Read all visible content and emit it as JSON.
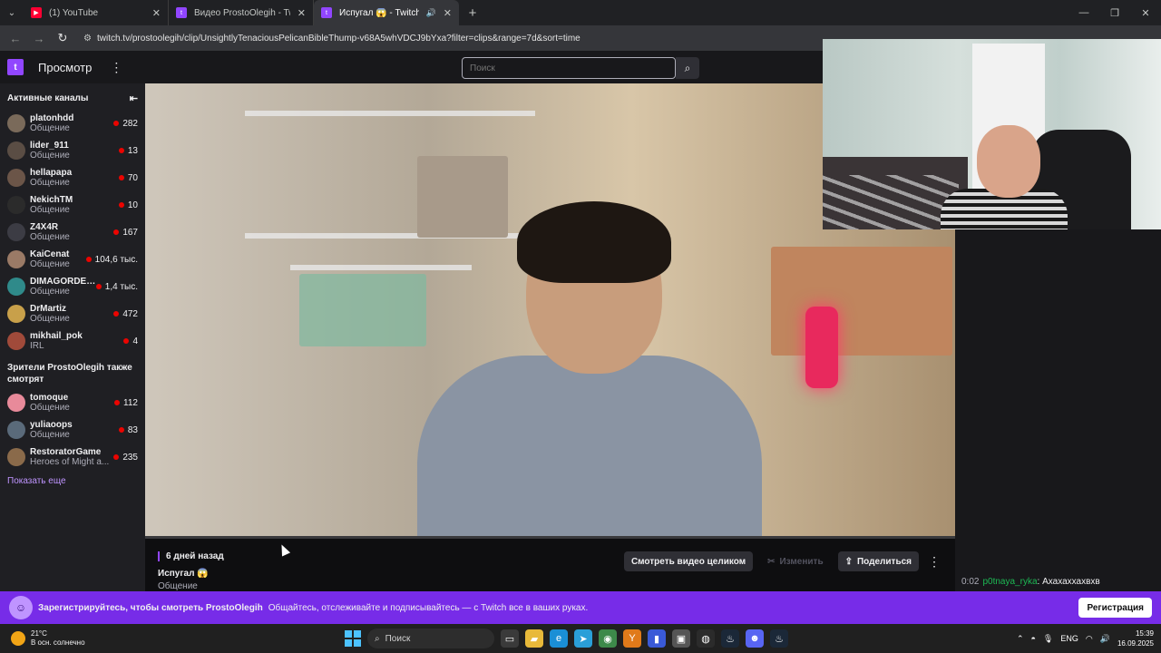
{
  "browser": {
    "tabs": [
      {
        "title": "(1) YouTube",
        "icon": "youtube-icon",
        "color": "#ff0033"
      },
      {
        "title": "Видео ProstoOlegih - Twitch",
        "icon": "twitch-icon",
        "color": "#9146ff"
      },
      {
        "title": "Испугал 😱 - Twitch",
        "icon": "twitch-icon",
        "color": "#9146ff",
        "active": true
      }
    ],
    "url": "twitch.tv/prostoolegih/clip/UnsightlyTenaciousPelicanBibleThump-v68A5whVDCJ9bYxa?filter=clips&range=7d&sort=time"
  },
  "topnav": {
    "browse": "Просмотр",
    "search_placeholder": "Поиск"
  },
  "sidebar": {
    "active_header": "Активные каналы",
    "channels": [
      {
        "name": "platonhdd",
        "category": "Общение",
        "viewers": "282",
        "color": "#7a6a5a"
      },
      {
        "name": "lider_911",
        "category": "Общение",
        "viewers": "13",
        "color": "#5a4d44"
      },
      {
        "name": "hellapapa",
        "category": "Общение",
        "viewers": "70",
        "color": "#6b5548"
      },
      {
        "name": "NekichTM",
        "category": "Общение",
        "viewers": "10",
        "color": "#2b2b2b"
      },
      {
        "name": "Z4X4R",
        "category": "Общение",
        "viewers": "167",
        "color": "#3c3c44"
      },
      {
        "name": "KaiCenat",
        "category": "Общение",
        "viewers": "104,6 тыс.",
        "color": "#9a7a66"
      },
      {
        "name": "DIMAGORDEY_",
        "category": "Общение",
        "viewers": "1,4 тыс.",
        "color": "#2f8a8a"
      },
      {
        "name": "DrMartiz",
        "category": "Общение",
        "viewers": "472",
        "color": "#c8a04a"
      },
      {
        "name": "mikhail_pok",
        "category": "IRL",
        "viewers": "4",
        "color": "#a04a3a"
      }
    ],
    "also_watch_header": "Зрители ProstoOlegih также смотрят",
    "recommended": [
      {
        "name": "tomoque",
        "category": "Общение",
        "viewers": "112",
        "color": "#e88a9a"
      },
      {
        "name": "yuliaoops",
        "category": "Общение",
        "viewers": "83",
        "color": "#5a6a7a"
      },
      {
        "name": "RestoratorGame",
        "category": "Heroes of Might a...",
        "viewers": "235",
        "color": "#8a6a4a"
      }
    ],
    "show_more": "Показать еще"
  },
  "clip": {
    "ago": "6 дней назад",
    "title": "Испугал 😱",
    "category": "Общение",
    "watch_full": "Смотреть видео целиком",
    "edit": "Изменить",
    "share": "Поделиться"
  },
  "chat": {
    "time": "0:02",
    "user": "p0tnaya_ryka",
    "message": ": Ахахаххахвхв"
  },
  "banner": {
    "bold": "Зарегистрируйтесь, чтобы смотреть ProstoOlegih",
    "text": "Общайтесь, отслеживайте и подписывайтесь — с Twitch все в ваших руках.",
    "register": "Регистрация"
  },
  "taskbar": {
    "temp": "21°C",
    "weather": "В осн. солнечно",
    "search": "Поиск",
    "lang": "ENG",
    "time": "15:39",
    "date": "16.09.2025"
  }
}
